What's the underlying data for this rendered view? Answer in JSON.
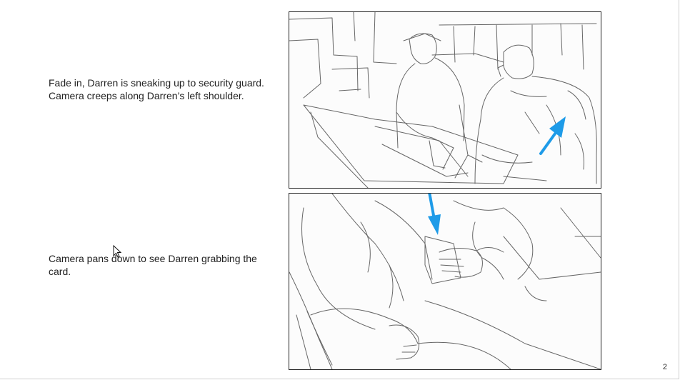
{
  "slide": {
    "page_number": "2",
    "shots": [
      {
        "caption": "Fade in, Darren is sneaking up to security guard.  Camera creeps along Darren’s left shoulder.",
        "arrow_direction": "up-right"
      },
      {
        "caption": "Camera pans down to see Darren grabbing the card.",
        "arrow_direction": "down"
      }
    ]
  },
  "colors": {
    "arrow": "#1e9be8",
    "sketch_line": "#555555",
    "frame_border": "#222222"
  }
}
